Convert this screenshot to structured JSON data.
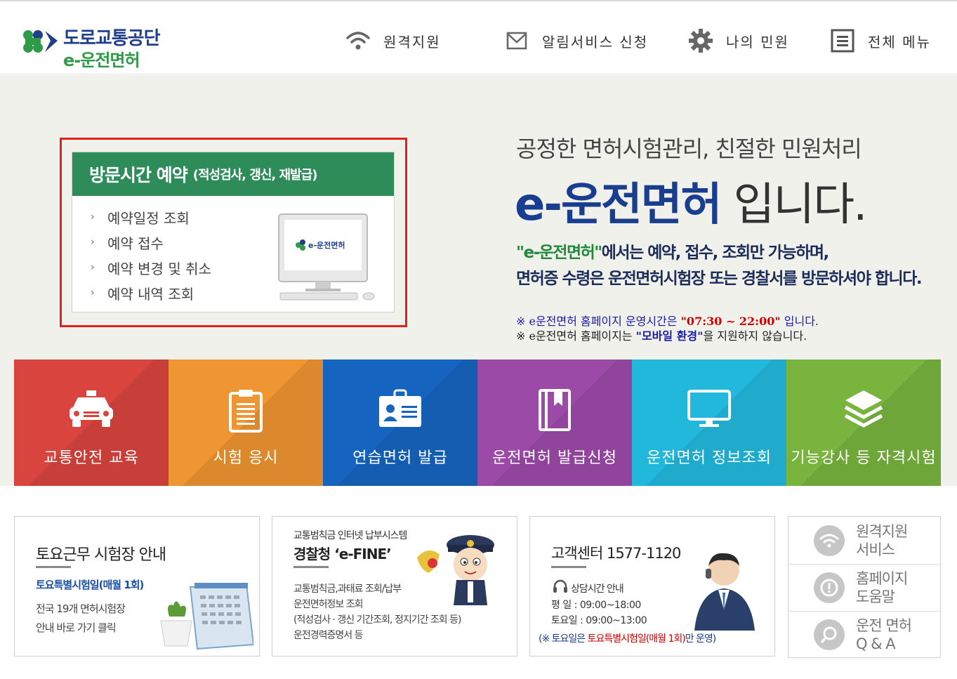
{
  "header": {
    "logo_line1": "도로교통공단",
    "logo_line2": "e-운전면허",
    "nav": [
      {
        "label": "원격지원",
        "icon": "wifi-icon"
      },
      {
        "label": "알림서비스 신청",
        "icon": "mail-icon"
      },
      {
        "label": "나의 민원",
        "icon": "gear-icon"
      },
      {
        "label": "전체 메뉴",
        "icon": "menu-icon"
      }
    ]
  },
  "reservation": {
    "title": "방문시간 예약",
    "subtitle": "(적성검사, 갱신, 재발급)",
    "items": [
      "예약일정 조회",
      "예약 접수",
      "예약 변경 및 취소",
      "예약 내역 조회"
    ],
    "monitor_logo": "e-운전면허"
  },
  "hero": {
    "tagline": "공정한 면허시험관리, 친절한 민원처리",
    "headline_brand": "e-운전면허",
    "headline_rest": "입니다.",
    "desc_quote": "\"e-운전면허\"",
    "desc_line1_rest": "에서는 예약, 접수, 조회만 가능하며,",
    "desc_line2": "면허증 수령은 운전면허시험장 또는 경찰서를 방문하셔야 합니다.",
    "notice1_pre": "※ e운전면허 홈페이지 운영시간은 ",
    "notice1_time": "\"07:30 ~ 22:00\"",
    "notice1_post": " 입니다.",
    "notice2_pre": "※ e운전면허 홈페이지는 ",
    "notice2_mobile": "\"모바일 환경\"",
    "notice2_post": "을 지원하지 않습니다."
  },
  "tiles": [
    {
      "label": "교통안전 교육",
      "icon": "car-icon",
      "color": "#d9443f"
    },
    {
      "label": "시험 응시",
      "icon": "clipboard-icon",
      "color": "#ef9531"
    },
    {
      "label": "연습면허 발급",
      "icon": "id-card-icon",
      "color": "#1565c0"
    },
    {
      "label": "운전면허 발급신청",
      "icon": "book-icon",
      "color": "#9c4aa8"
    },
    {
      "label": "운전면허 정보조회",
      "icon": "monitor-icon",
      "color": "#22b8dc"
    },
    {
      "label": "기능강사 등 자격시험",
      "icon": "layers-icon",
      "color": "#78b43e"
    }
  ],
  "saturday": {
    "title": "토요근무 시험장 안내",
    "subtitle": "토요특별시험일(매월 1회)",
    "desc1": "전국 19개 면허시험장",
    "desc2": "안내 바로 가기 클릭"
  },
  "efine": {
    "top": "교통범칙금 인터넷 납부시스템",
    "title": "경찰청 ‘e-FINE’",
    "lines": [
      "교통범칙금,과태료 조회/납부",
      "운전면허정보 조회",
      "(적성검사 · 갱신 기간조회, 정지기간 조회 등)",
      "운전경력증명서 등"
    ]
  },
  "customer": {
    "title": "고객센터 1577-1120",
    "hours_label": "상담시간 안내",
    "weekday_label": "평    일 :",
    "weekday_hours": "09:00~18:00",
    "saturday_label": "토요일 :",
    "saturday_hours": "09:00~13:00",
    "note_pre": "(※ 토요일은 ",
    "note_red": "토요특별시험일(매월 1회)",
    "note_post": "만 운영)"
  },
  "quick": [
    {
      "line1": "원격지원",
      "line2": "서비스",
      "icon": "wifi-icon"
    },
    {
      "line1": "홈페이지",
      "line2": "도움말",
      "icon": "help-icon"
    },
    {
      "line1": "운전 면허",
      "line2": "Q & A",
      "icon": "search-icon"
    }
  ]
}
